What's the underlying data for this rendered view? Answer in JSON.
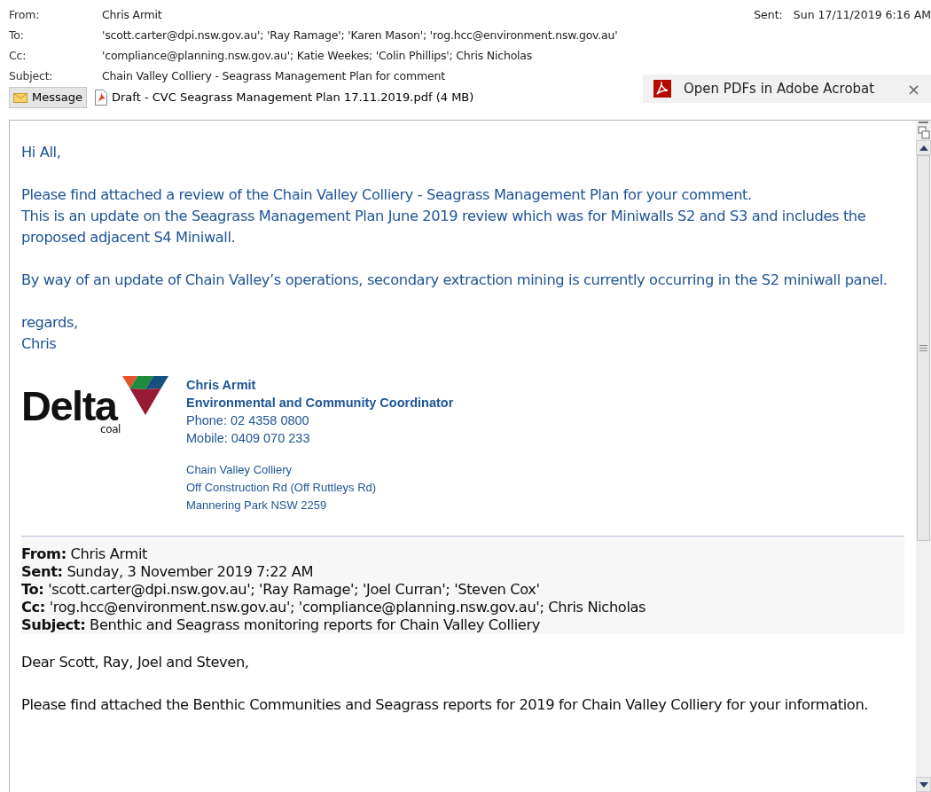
{
  "header": {
    "fields": [
      {
        "label": "From:",
        "value": "Chris Armit"
      },
      {
        "label": "To:",
        "value": "'scott.carter@dpi.nsw.gov.au'; 'Ray Ramage'; 'Karen Mason'; 'rog.hcc@environment.nsw.gov.au'"
      },
      {
        "label": "Cc:",
        "value": "'compliance@planning.nsw.gov.au'; Katie Weekes; 'Colin Phillips'; Chris Nicholas"
      },
      {
        "label": "Subject:",
        "value": "Chain Valley Colliery - Seagrass Management Plan for comment"
      }
    ],
    "sent": {
      "label": "Sent:",
      "value": "Sun 17/11/2019 6:16 AM"
    }
  },
  "pdf_banner": {
    "text": "Open PDFs in Adobe Acrobat",
    "close": "×"
  },
  "attachments": [
    {
      "kind": "message",
      "label": "Message",
      "selected": true
    },
    {
      "kind": "pdf",
      "label": "Draft - CVC Seagrass Management Plan 17.11.2019.pdf (4 MB)",
      "selected": false
    }
  ],
  "body": {
    "paragraphs": [
      [
        "Hi All,"
      ],
      [
        "Please find attached a review of the Chain Valley Colliery - Seagrass Management Plan for your comment.",
        "This is an update on the Seagrass Management Plan June 2019 review which was for Miniwalls S2 and S3 and includes the proposed adjacent S4 Miniwall."
      ],
      [
        "By way of an update of Chain Valley’s operations, secondary extraction mining is currently occurring in the S2 miniwall panel."
      ],
      [
        "regards,",
        "Chris"
      ]
    ],
    "signature": {
      "logo_word": "Delta",
      "logo_sub": "coal",
      "name": "Chris Armit",
      "title": "Environmental and Community Coordinator",
      "contact": [
        "Phone: 02 4358 0800",
        "Mobile: 0409 070 233"
      ],
      "address": [
        "Chain Valley Colliery",
        "Off Construction Rd (Off Ruttleys Rd)",
        "Mannering Park NSW 2259"
      ]
    },
    "quoted_header": [
      {
        "label": "From:",
        "value": "Chris Armit"
      },
      {
        "label": "Sent:",
        "value": "Sunday, 3 November 2019 7:22 AM"
      },
      {
        "label": "To:",
        "value": "'scott.carter@dpi.nsw.gov.au'; 'Ray Ramage'; 'Joel Curran'; 'Steven Cox'"
      },
      {
        "label": "Cc:",
        "value": "'rog.hcc@environment.nsw.gov.au'; 'compliance@planning.nsw.gov.au'; Chris Nicholas"
      },
      {
        "label": "Subject:",
        "value": "Benthic and Seagrass monitoring reports for Chain Valley Colliery"
      }
    ],
    "quoted_paragraphs": [
      "Dear Scott, Ray, Joel and Steven,",
      "Please find attached the Benthic Communities and Seagrass reports for 2019 for Chain Valley Colliery for your information."
    ]
  }
}
